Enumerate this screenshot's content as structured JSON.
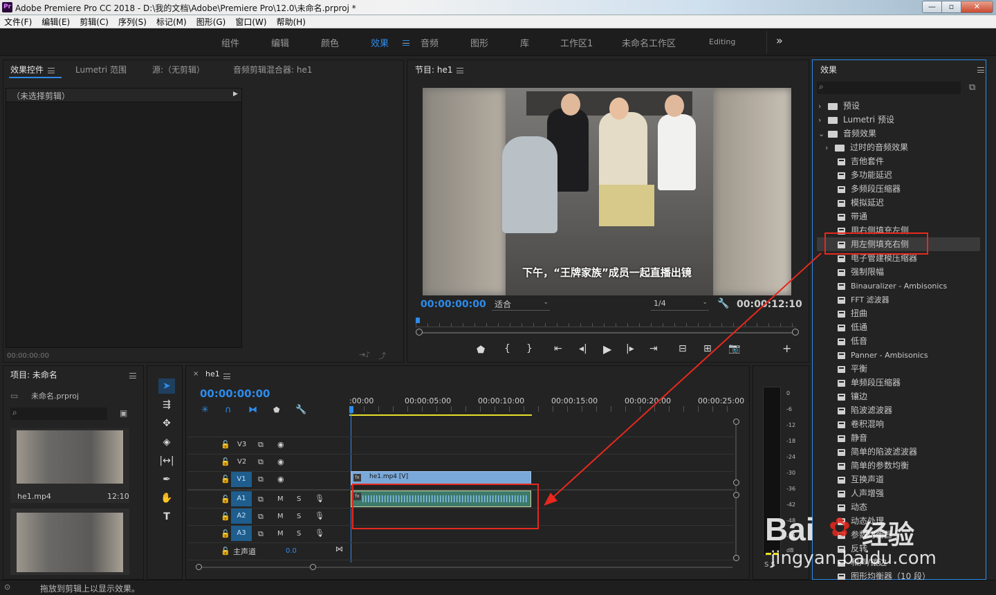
{
  "window": {
    "title": "Adobe Premiere Pro CC 2018 - D:\\我的文档\\Adobe\\Premiere Pro\\12.0\\未命名.prproj *",
    "app_icon": "Pr"
  },
  "menu": [
    "文件(F)",
    "编辑(E)",
    "剪辑(C)",
    "序列(S)",
    "标记(M)",
    "图形(G)",
    "窗口(W)",
    "帮助(H)"
  ],
  "workspaces": {
    "items": [
      "组件",
      "编辑",
      "颜色",
      "效果",
      "音频",
      "图形",
      "库",
      "工作区1",
      "未命名工作区",
      "Editing"
    ],
    "active": "效果",
    "more": "»"
  },
  "source_panel": {
    "tabs": [
      "效果控件",
      "Lumetri 范围",
      "源:（无剪辑）",
      "音频剪辑混合器: he1"
    ],
    "no_clip": "（未选择剪辑）",
    "timecode": "00:00:00:00"
  },
  "program": {
    "tab": "节目: he1",
    "timecode": "00:00:00:00",
    "fit": "适合",
    "resolution": "1/4",
    "duration": "00:00:12:10",
    "subtitle": "下午，“王牌家族”成员一起直播出镜"
  },
  "project": {
    "tab": "项目: 未命名",
    "file": "未命名.prproj",
    "clips": [
      {
        "name": "he1.mp4",
        "duration": "12:10"
      },
      {
        "name": "",
        "duration": ""
      }
    ]
  },
  "timeline": {
    "tab": "he1",
    "timecode": "00:00:00:00",
    "ruler": [
      ":00:00",
      "00:00:05:00",
      "00:00:10:00",
      "00:00:15:00",
      "00:00:20:00",
      "00:00:25:00"
    ],
    "video_tracks": [
      "V3",
      "V2",
      "V1"
    ],
    "audio_tracks": [
      "A1",
      "A2",
      "A3"
    ],
    "master": "主声道",
    "master_value": "0.0",
    "clip_label": "he1.mp4 [V]",
    "track_btn_m": "M",
    "track_btn_s": "S"
  },
  "meter": {
    "scale": [
      "0",
      "-6",
      "-12",
      "-18",
      "-24",
      "-30",
      "-36",
      "-42",
      "-48",
      "-54"
    ],
    "unit": "dB",
    "bottom": "S S"
  },
  "effects": {
    "tab": "效果",
    "items": [
      {
        "label": "预设",
        "type": "folder",
        "level": 0,
        "chev": "›"
      },
      {
        "label": "Lumetri 预设",
        "type": "folder",
        "level": 0,
        "chev": "›"
      },
      {
        "label": "音频效果",
        "type": "folder",
        "level": 0,
        "chev": "⌄"
      },
      {
        "label": "过时的音频效果",
        "type": "folder",
        "level": 1,
        "chev": "›"
      },
      {
        "label": "吉他套件",
        "type": "fx",
        "level": 1
      },
      {
        "label": "多功能延迟",
        "type": "fx",
        "level": 1
      },
      {
        "label": "多频段压缩器",
        "type": "fx",
        "level": 1
      },
      {
        "label": "模拟延迟",
        "type": "fx",
        "level": 1
      },
      {
        "label": "带通",
        "type": "fx",
        "level": 1
      },
      {
        "label": "用右侧填充左侧",
        "type": "fx",
        "level": 1
      },
      {
        "label": "用左侧填充右侧",
        "type": "fx",
        "level": 1,
        "selected": true
      },
      {
        "label": "电子管建模压缩器",
        "type": "fx",
        "level": 1
      },
      {
        "label": "强制限幅",
        "type": "fx",
        "level": 1
      },
      {
        "label": "Binauralizer - Ambisonics",
        "type": "fx",
        "level": 1
      },
      {
        "label": "FFT 滤波器",
        "type": "fx",
        "level": 1
      },
      {
        "label": "扭曲",
        "type": "fx",
        "level": 1
      },
      {
        "label": "低通",
        "type": "fx",
        "level": 1
      },
      {
        "label": "低音",
        "type": "fx",
        "level": 1
      },
      {
        "label": "Panner - Ambisonics",
        "type": "fx",
        "level": 1
      },
      {
        "label": "平衡",
        "type": "fx",
        "level": 1
      },
      {
        "label": "单频段压缩器",
        "type": "fx",
        "level": 1
      },
      {
        "label": "镶边",
        "type": "fx",
        "level": 1
      },
      {
        "label": "陷波滤波器",
        "type": "fx",
        "level": 1
      },
      {
        "label": "卷积混响",
        "type": "fx",
        "level": 1
      },
      {
        "label": "静音",
        "type": "fx",
        "level": 1
      },
      {
        "label": "简单的陷波滤波器",
        "type": "fx",
        "level": 1
      },
      {
        "label": "简单的参数均衡",
        "type": "fx",
        "level": 1
      },
      {
        "label": "互换声道",
        "type": "fx",
        "level": 1
      },
      {
        "label": "人声增强",
        "type": "fx",
        "level": 1
      },
      {
        "label": "动态",
        "type": "fx",
        "level": 1
      },
      {
        "label": "动态处理",
        "type": "fx",
        "level": 1
      },
      {
        "label": "参数均衡器",
        "type": "fx",
        "level": 1
      },
      {
        "label": "反转",
        "type": "fx",
        "level": 1
      },
      {
        "label": "和声/镶边",
        "type": "fx",
        "level": 1
      },
      {
        "label": "图形均衡器（10 段）",
        "type": "fx",
        "level": 1
      }
    ]
  },
  "status": {
    "text": "拖放到剪辑上以显示效果。"
  },
  "watermark": {
    "brand": "Bai",
    "brand2": "经验",
    "url": "jingyan.baidu.com"
  },
  "colors": {
    "accent": "#2d8ceb",
    "highlight": "#e8281e",
    "clip_video": "#7aa9d9",
    "clip_audio": "#3d7a6a"
  }
}
